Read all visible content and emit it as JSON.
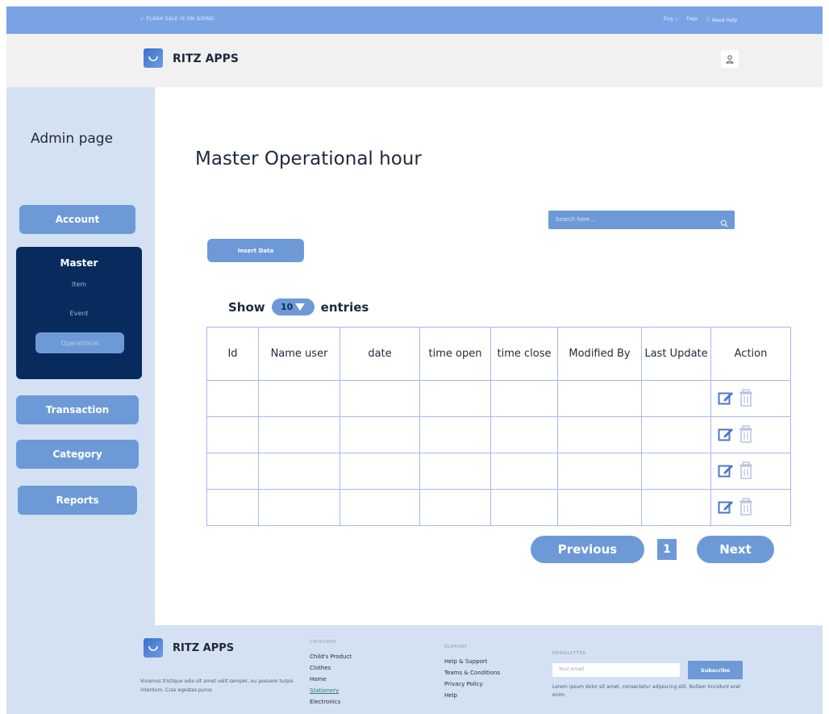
{
  "topbar": {
    "flash_text": "✓ FLASH SALE IS ON GOING",
    "lang": "Eng ⌄",
    "faqs": "Faqs",
    "help": "ⓘ Need Help"
  },
  "header": {
    "brand": "RITZ APPS",
    "user_icon": "user-icon"
  },
  "sidebar": {
    "title": "Admin page",
    "account": "Account",
    "master": {
      "title": "Master",
      "items": [
        "Item",
        "Event",
        "Operational"
      ],
      "active": "Operational"
    },
    "transaction": "Transaction",
    "category": "Category",
    "reports": "Reports"
  },
  "main": {
    "title": "Master Operational hour",
    "search_placeholder": "Search here...",
    "insert_label": "Insert Data",
    "show_label": "Show",
    "show_value": "10",
    "entries_label": "entries",
    "columns": [
      "Id",
      "Name user",
      "date",
      "time open",
      "time close",
      "Modified By",
      "Last Update",
      "Action"
    ],
    "rows": [
      [
        "",
        "",
        "",
        "",
        "",
        "",
        ""
      ],
      [
        "",
        "",
        "",
        "",
        "",
        "",
        ""
      ],
      [
        "",
        "",
        "",
        "",
        "",
        "",
        ""
      ],
      [
        "",
        "",
        "",
        "",
        "",
        "",
        ""
      ]
    ],
    "pagination": {
      "previous": "Previous",
      "page": "1",
      "next": "Next"
    }
  },
  "footer": {
    "brand": "RITZ APPS",
    "about": "Vivamus tristique odio sit amet velit semper, eu posuere turpis interdum. Cras egestas purus",
    "category": {
      "header": "CATEGORY",
      "links": [
        "Child's Product",
        "Clothes",
        "Home",
        "Stationery",
        "Electronics"
      ],
      "highlight": "Stationery"
    },
    "support": {
      "header": "SUPPORT",
      "links": [
        "Help & Support",
        "Teams & Conditions",
        "Privacy Policy",
        "Help"
      ]
    },
    "newsletter": {
      "header": "NEWSLETTER",
      "placeholder": "Your email",
      "button": "Subscribe",
      "description": "Lorem ipsum dolor sit amet, consectetur adipiscing elit. Nullam tincidunt erat enim."
    }
  },
  "colors": {
    "topbar": "#7aa3e6",
    "button": "#6d9ad7",
    "sidebar_bg": "#d3e1f3",
    "master_bg": "#082b5d",
    "table_border": "#a9b5f2"
  }
}
